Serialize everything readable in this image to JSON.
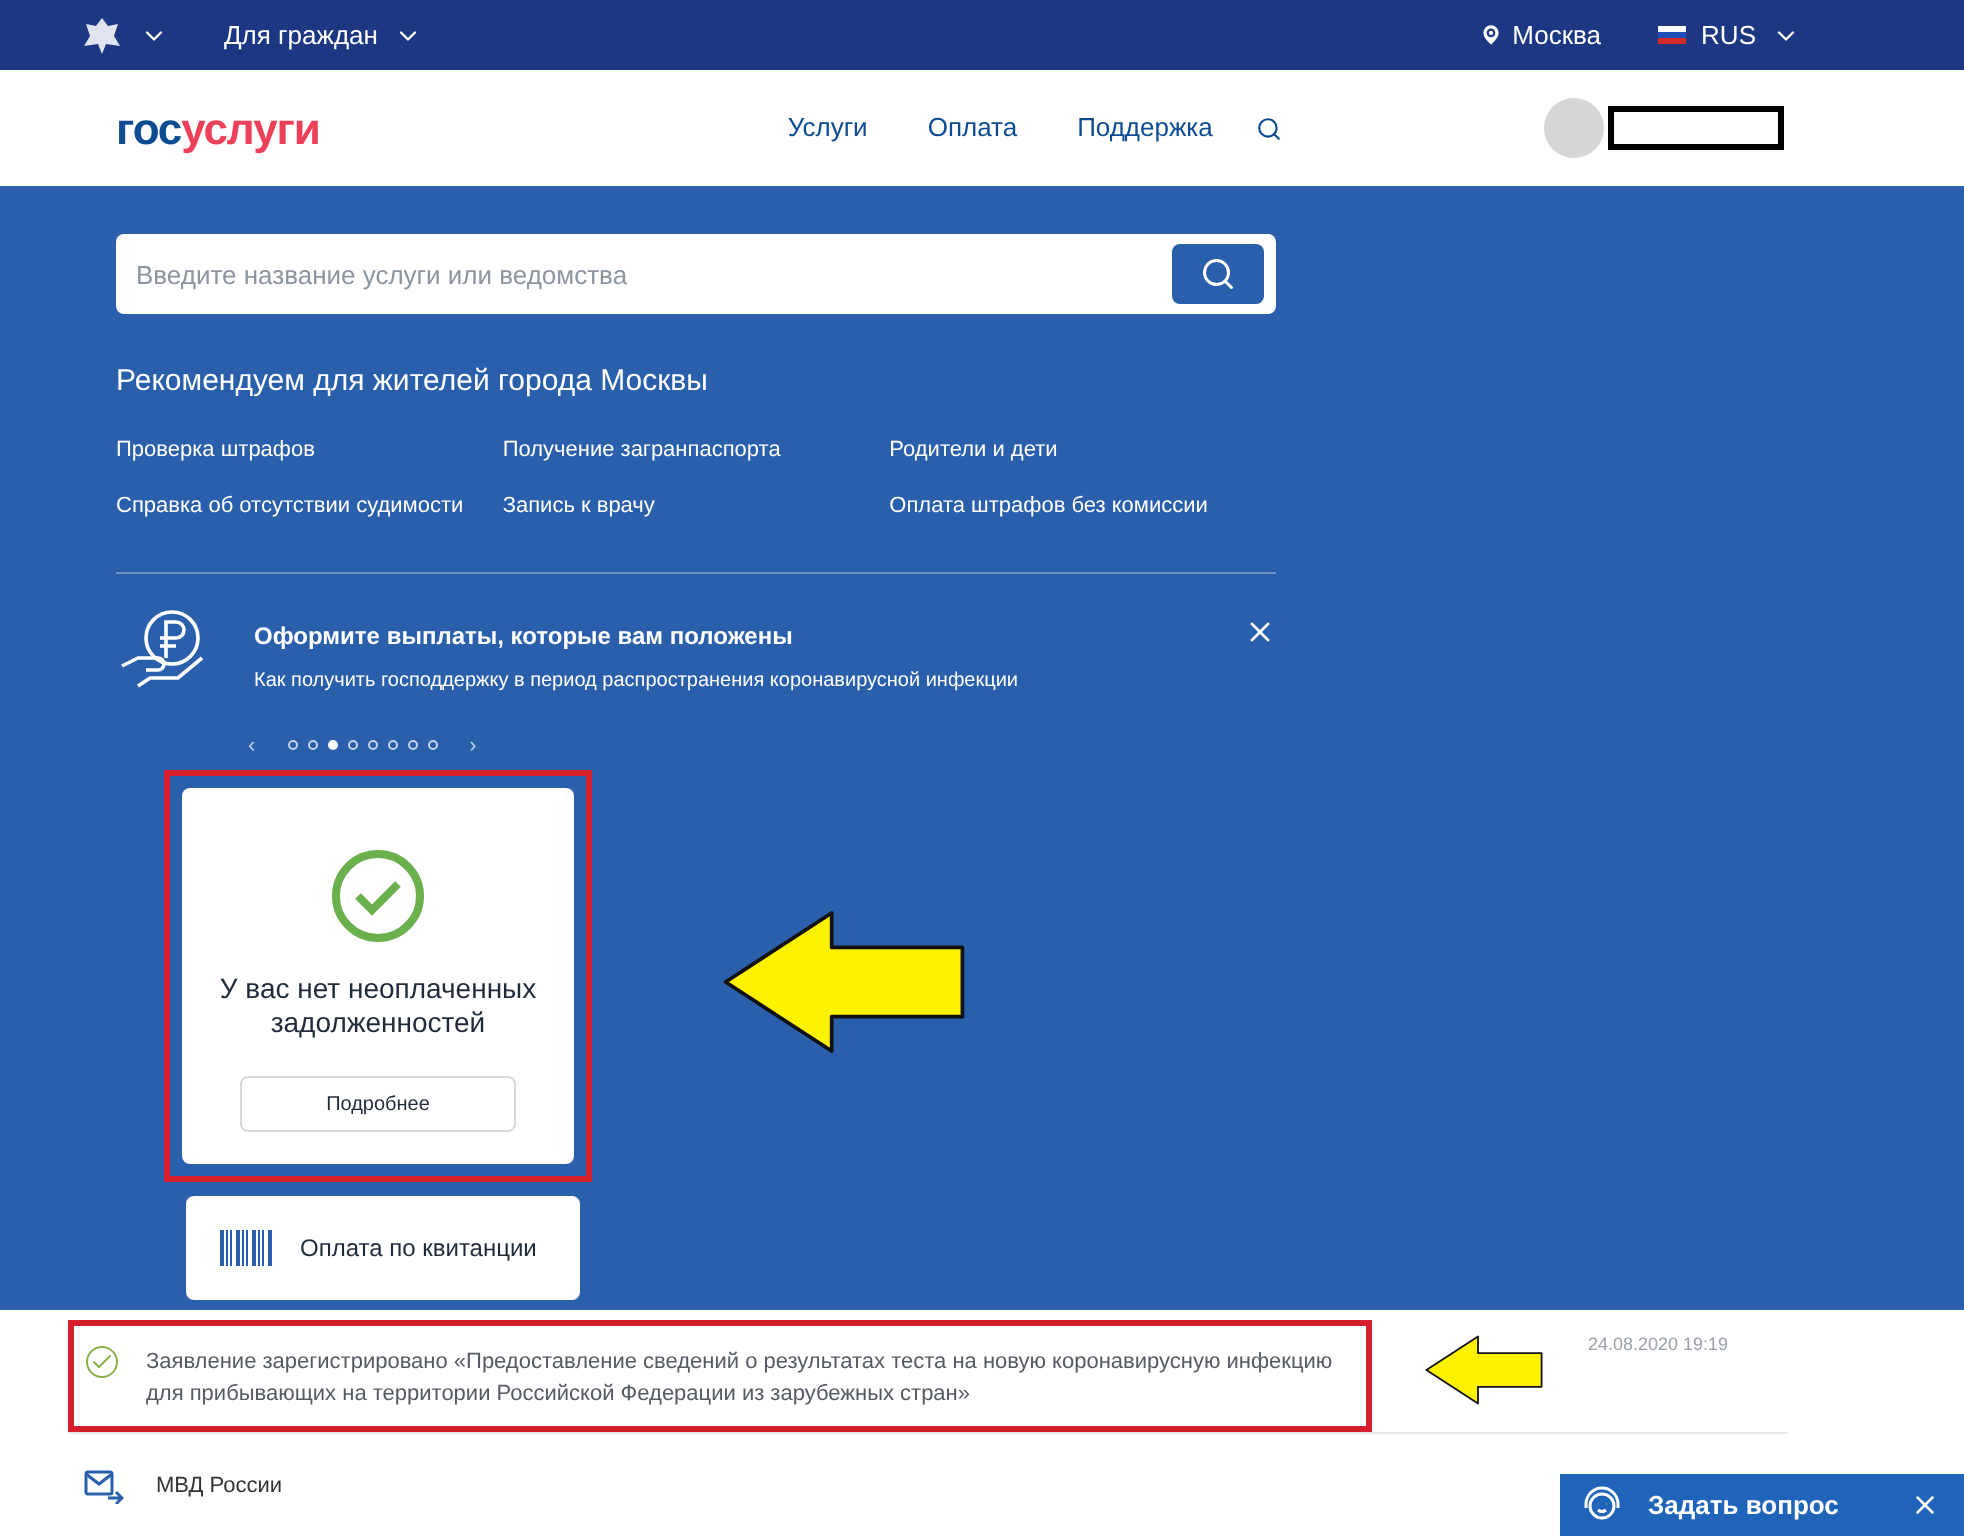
{
  "top_bar": {
    "menu": "Для граждан",
    "city": "Москва",
    "language": "RUS"
  },
  "header": {
    "logo": {
      "part_1": "гос",
      "part_2": "услуги"
    },
    "nav": [
      "Услуги",
      "Оплата",
      "Поддержка"
    ]
  },
  "search": {
    "placeholder": "Введите название услуги или ведомства"
  },
  "recommendations": {
    "title": "Рекомендуем для жителей города Москвы",
    "links": [
      "Проверка штрафов",
      "Получение загранпаспорта",
      "Родители и дети",
      "Справка об отсутствии судимости",
      "Запись к врачу",
      "Оплата штрафов без комиссии"
    ]
  },
  "banner": {
    "title": "Оформите выплаты, которые вам положены",
    "text": "Как получить господдержку в период распространения коронавирусной инфекции"
  },
  "carousel": {
    "prev": "‹",
    "next": "›",
    "dots": [
      {
        "selected": false
      },
      {
        "selected": false
      },
      {
        "selected": true
      },
      {
        "selected": false
      },
      {
        "selected": false
      },
      {
        "selected": false
      },
      {
        "selected": false
      },
      {
        "selected": false
      }
    ]
  },
  "debt_card": {
    "message": "У вас нет неоплаченных задолженностей",
    "button": "Подробнее"
  },
  "receipt_card": {
    "label": "Оплата по квитанции"
  },
  "notifications": [
    {
      "kind": "status",
      "text": "Заявление зарегистрировано «Предоставление сведений о результатах теста на новую коронавирусную инфекцию для прибывающих на территории Российской Федерации из зарубежных стран»",
      "date": "24.08.2020 19:19"
    },
    {
      "kind": "agency",
      "text": "МВД России"
    }
  ],
  "chat": {
    "label": "Задать вопрос"
  }
}
